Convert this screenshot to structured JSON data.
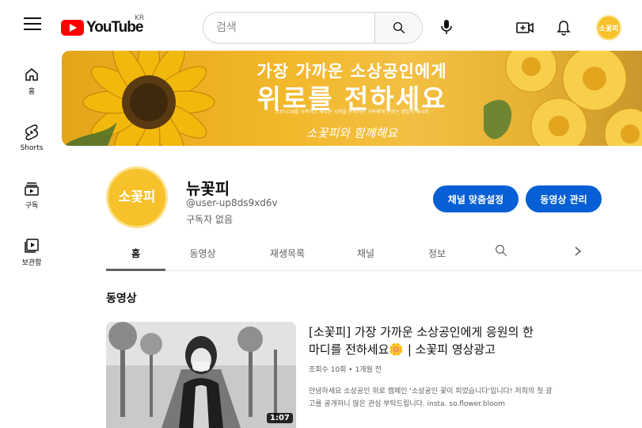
{
  "header": {
    "logo_text": "YouTube",
    "logo_region": "KR",
    "search_placeholder": "검색"
  },
  "nav": [
    {
      "label": "홈",
      "icon": "home-icon"
    },
    {
      "label": "Shorts",
      "icon": "shorts-icon"
    },
    {
      "label": "구독",
      "icon": "subscriptions-icon"
    },
    {
      "label": "보관함",
      "icon": "library-icon"
    }
  ],
  "banner": {
    "line1": "가장 가까운 소상공인에게",
    "line2": "위로를 전하세요",
    "subtext": "코로나19를 극복하고 새로운 시작을 준비하는 가족에게 전하는 희망의 메시지",
    "script": "소꽃피와 함께해요"
  },
  "channel": {
    "avatar_text": "소꽃피",
    "name": "뉴꽃피",
    "handle": "@user-up8ds9xd6v",
    "subscribers": "구독자 없음",
    "customize_label": "채널 맞춤설정",
    "manage_label": "동영상 관리"
  },
  "tabs": [
    {
      "label": "홈",
      "active": true
    },
    {
      "label": "동영상",
      "active": false
    },
    {
      "label": "재생목록",
      "active": false
    },
    {
      "label": "채널",
      "active": false
    },
    {
      "label": "정보",
      "active": false
    }
  ],
  "section_title": "동영상",
  "video": {
    "title_line1": "[소꽃피] 가장 가까운 소상공인에게 응원의 한",
    "title_line2": "마디를 전하세요",
    "title_emoji": "🌼",
    "title_line2_suffix": " | 소꽃피 영상광고",
    "meta": "조회수 10회 • 1개월 전",
    "description_line1": "안녕하세요 소상공인 위로 캠페인 '소상공인 꽃이 피었습니다'입니다! 저희의 첫 광",
    "description_line2": "고를 공개하니 많은 관심 부탁드립니다. insta. so.flower.bloom",
    "duration": "1:07"
  },
  "colors": {
    "accent_blue": "#065fd4",
    "brand_red": "#ff0000",
    "banner_yellow": "#f3b82c"
  }
}
